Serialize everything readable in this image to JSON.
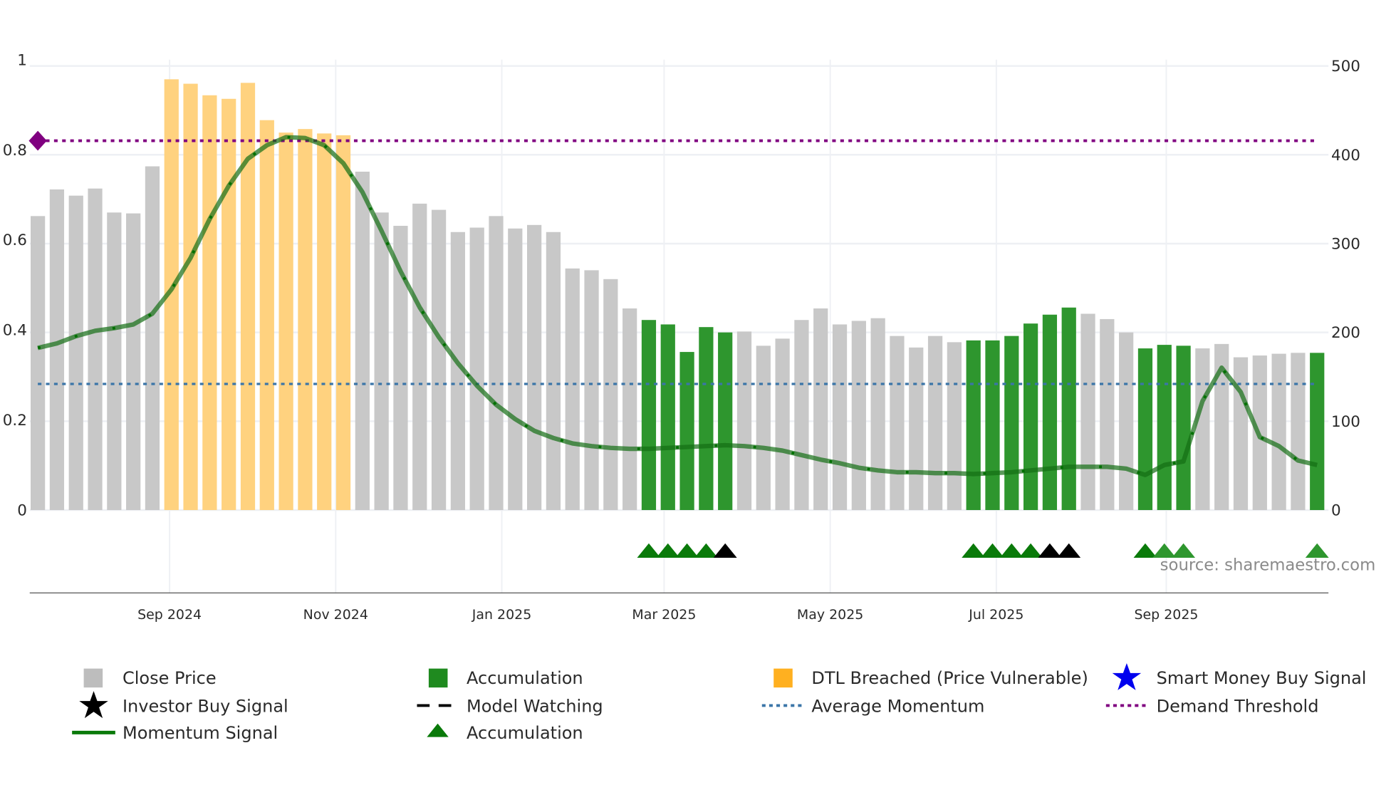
{
  "chart_data": {
    "type": "bar",
    "title": "",
    "source": "source: sharemaestro.com",
    "left_axis": {
      "range": [
        0,
        1
      ],
      "ticks": [
        "0",
        "0.2",
        "0.4",
        "0.6",
        "0.8",
        "1"
      ],
      "tick_values": [
        0,
        0.2,
        0.4,
        0.6,
        0.8,
        1
      ]
    },
    "right_axis": {
      "range": [
        0,
        500
      ],
      "ticks": [
        "0",
        "100",
        "200",
        "300",
        "400",
        "500"
      ],
      "tick_values": [
        0,
        100,
        200,
        300,
        400,
        500
      ]
    },
    "x_ticks": [
      {
        "label": "Sep 2024",
        "x": 6.9
      },
      {
        "label": "Nov 2024",
        "x": 15.6
      },
      {
        "label": "Jan 2025",
        "x": 24.3
      },
      {
        "label": "Mar 2025",
        "x": 32.8
      },
      {
        "label": "May 2025",
        "x": 41.5
      },
      {
        "label": "Jul 2025",
        "x": 50.2
      },
      {
        "label": "Sep 2025",
        "x": 59.1
      }
    ],
    "grid": true,
    "legend_placement": "bottom",
    "close_price": [
      331,
      361,
      354,
      362,
      335,
      334,
      387,
      485,
      480,
      467,
      463,
      481,
      439,
      425,
      429,
      424,
      422,
      381,
      335,
      320,
      345,
      338,
      313,
      318,
      331,
      317,
      321,
      313,
      272,
      270,
      260,
      227,
      214,
      209,
      178,
      206,
      200,
      201,
      185,
      193,
      214,
      227,
      209,
      213,
      216,
      196,
      183,
      196,
      189,
      191,
      191,
      196,
      210,
      220,
      228,
      221,
      215,
      200,
      182,
      186,
      185,
      182,
      187,
      172,
      174,
      176,
      177,
      177
    ],
    "bar_state": [
      "p",
      "p",
      "p",
      "p",
      "p",
      "p",
      "p",
      "d",
      "d",
      "d",
      "d",
      "d",
      "d",
      "d",
      "d",
      "d",
      "d",
      "p",
      "p",
      "p",
      "p",
      "p",
      "p",
      "p",
      "p",
      "p",
      "p",
      "p",
      "p",
      "p",
      "p",
      "p",
      "a",
      "a",
      "a",
      "a",
      "a",
      "p",
      "p",
      "p",
      "p",
      "p",
      "p",
      "p",
      "p",
      "p",
      "p",
      "p",
      "p",
      "a",
      "a",
      "a",
      "a",
      "a",
      "a",
      "p",
      "p",
      "p",
      "a",
      "a",
      "a",
      "p",
      "p",
      "p",
      "p",
      "p",
      "p",
      "a"
    ],
    "momentum": [
      0.36,
      0.37,
      0.386,
      0.398,
      0.404,
      0.412,
      0.436,
      0.49,
      0.56,
      0.646,
      0.72,
      0.78,
      0.81,
      0.828,
      0.826,
      0.81,
      0.77,
      0.706,
      0.62,
      0.53,
      0.45,
      0.384,
      0.326,
      0.276,
      0.234,
      0.202,
      0.176,
      0.16,
      0.148,
      0.142,
      0.138,
      0.136,
      0.136,
      0.138,
      0.14,
      0.142,
      0.144,
      0.142,
      0.138,
      0.132,
      0.122,
      0.112,
      0.104,
      0.094,
      0.088,
      0.084,
      0.084,
      0.082,
      0.082,
      0.08,
      0.082,
      0.084,
      0.088,
      0.092,
      0.096,
      0.096,
      0.096,
      0.092,
      0.078,
      0.1,
      0.108,
      0.242,
      0.316,
      0.262,
      0.162,
      0.142,
      0.11,
      0.1
    ],
    "demand_threshold": 0.82,
    "average_momentum": 0.28,
    "signals": [
      {
        "x": 32,
        "type": "accumulation"
      },
      {
        "x": 33,
        "type": "accumulation"
      },
      {
        "x": 34,
        "type": "accumulation"
      },
      {
        "x": 35,
        "type": "accumulation"
      },
      {
        "x": 36,
        "type": "watching"
      },
      {
        "x": 49,
        "type": "accumulation"
      },
      {
        "x": 50,
        "type": "accumulation"
      },
      {
        "x": 51,
        "type": "accumulation"
      },
      {
        "x": 52,
        "type": "accumulation"
      },
      {
        "x": 53,
        "type": "watching"
      },
      {
        "x": 54,
        "type": "watching"
      },
      {
        "x": 58,
        "type": "accumulation"
      },
      {
        "x": 59,
        "type": "accumulation-light"
      },
      {
        "x": 60,
        "type": "accumulation-light"
      },
      {
        "x": 67,
        "type": "accumulation-light"
      }
    ],
    "colors": {
      "price": "#c8c8c8",
      "dtl": "#ffd27f",
      "accum": "#2e962e",
      "momentum": "#2f7f2f",
      "demand": "#800080",
      "avg": "#3b75a8"
    }
  },
  "legend": {
    "close_price": "Close Price",
    "accumulation_bar": "Accumulation",
    "dtl": "DTL Breached (Price Vulnerable)",
    "smart_money": "Smart Money Buy Signal",
    "investor_buy": "Investor Buy Signal",
    "model_watching": "Model Watching",
    "avg_momentum": "Average Momentum",
    "demand_threshold": "Demand Threshold",
    "momentum_signal": "Momentum Signal",
    "accumulation_marker": "Accumulation"
  }
}
